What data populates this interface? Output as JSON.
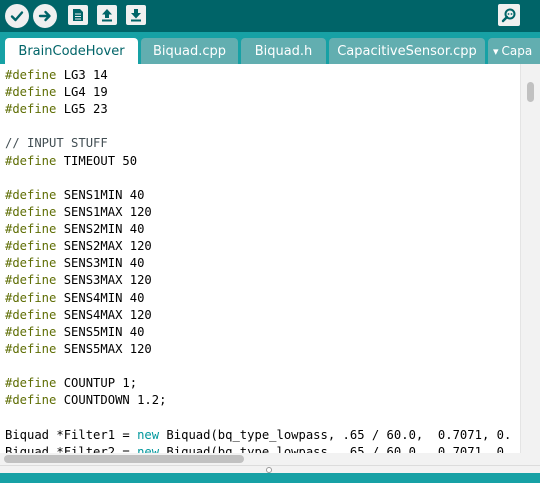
{
  "toolbar": {
    "buttons": [
      {
        "name": "verify",
        "icon": "checkmark-icon"
      },
      {
        "name": "upload",
        "icon": "arrow-right-icon"
      },
      {
        "name": "new",
        "icon": "document-icon"
      },
      {
        "name": "open",
        "icon": "arrow-up-icon"
      },
      {
        "name": "save",
        "icon": "arrow-down-icon"
      },
      {
        "name": "serial-monitor",
        "icon": "magnifier-icon"
      }
    ],
    "colors": {
      "background": "#006468",
      "button": "#f0f0f0"
    }
  },
  "tabs": [
    {
      "label": "BrainCodeHover",
      "active": true
    },
    {
      "label": "Biquad.cpp",
      "active": false
    },
    {
      "label": "Biquad.h",
      "active": false
    },
    {
      "label": "CapacitiveSensor.cpp",
      "active": false
    },
    {
      "label": "▾",
      "extra": "Capa",
      "active": false
    }
  ],
  "editor": {
    "lines": [
      "#define LG3 14",
      "#define LG4 19",
      "#define LG5 23",
      "",
      "// INPUT STUFF",
      "#define TIMEOUT 50",
      "",
      "#define SENS1MIN 40",
      "#define SENS1MAX 120",
      "#define SENS2MIN 40",
      "#define SENS2MAX 120",
      "#define SENS3MIN 40",
      "#define SENS3MAX 120",
      "#define SENS4MIN 40",
      "#define SENS4MAX 120",
      "#define SENS5MIN 40",
      "#define SENS5MAX 120",
      "",
      "#define COUNTUP 1;",
      "#define COUNTDOWN 1.2;",
      "",
      "Biquad *Filter1 = new Biquad(bq_type_lowpass, .65 / 60.0,  0.7071, 0.",
      "Biquad *Filter2 = new Biquad(bq_type_lowpass, .65 / 60.0,  0.7071, 0."
    ],
    "colors": {
      "keyword": "#5e6d03",
      "comment": "#434f54",
      "new": "#00979c",
      "text": "#000000"
    }
  }
}
